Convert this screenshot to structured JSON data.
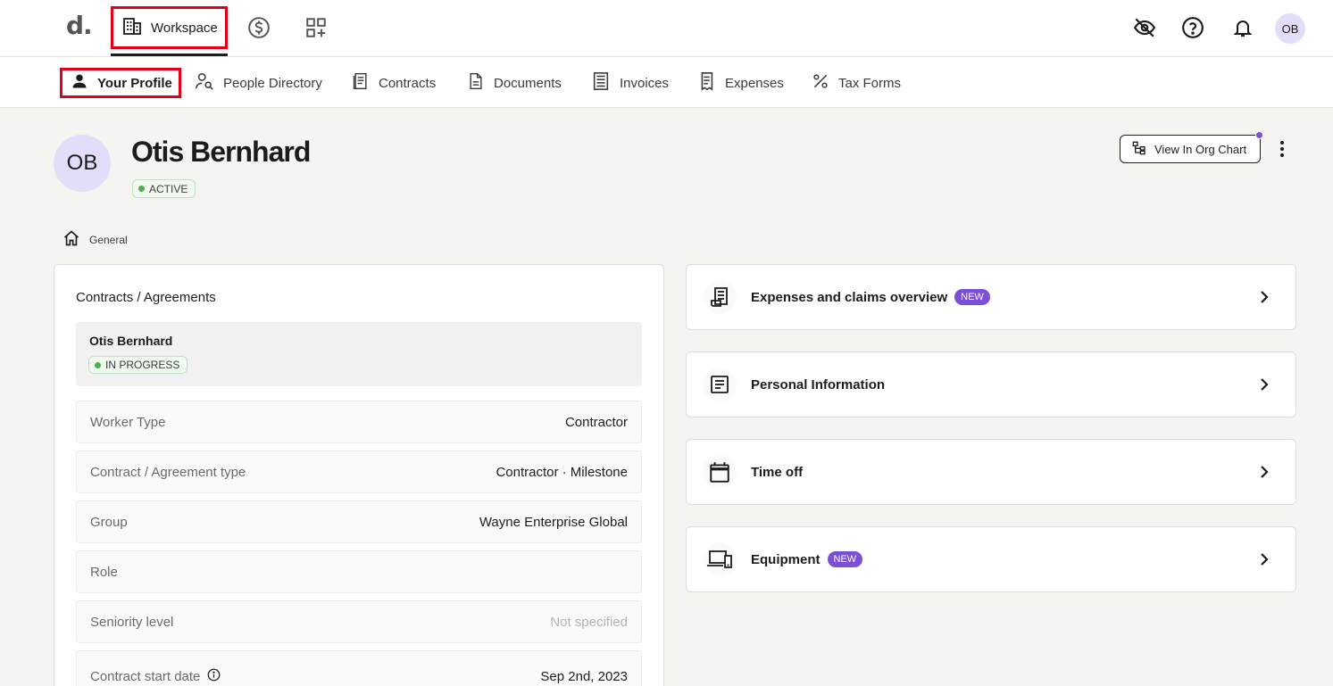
{
  "topbar": {
    "logo": "d.",
    "workspace_label": "Workspace",
    "avatar_initials": "OB",
    "icons": [
      "building-icon",
      "dollar-circle-icon",
      "apps-add-icon",
      "eye-off-icon",
      "help-icon",
      "bell-icon"
    ]
  },
  "subnav": {
    "items": [
      {
        "label": "Your Profile",
        "icon": "person-icon"
      },
      {
        "label": "People Directory",
        "icon": "person-search-icon"
      },
      {
        "label": "Contracts",
        "icon": "contracts-icon"
      },
      {
        "label": "Documents",
        "icon": "document-icon"
      },
      {
        "label": "Invoices",
        "icon": "invoice-icon"
      },
      {
        "label": "Expenses",
        "icon": "expense-icon"
      },
      {
        "label": "Tax Forms",
        "icon": "percent-icon"
      }
    ]
  },
  "profile": {
    "initials": "OB",
    "name": "Otis Bernhard",
    "status": "ACTIVE",
    "org_chart_button": "View In Org Chart"
  },
  "breadcrumb": {
    "label": "General"
  },
  "contracts": {
    "title": "Contracts / Agreements",
    "contract_name": "Otis Bernhard",
    "contract_status": "IN PROGRESS",
    "rows": [
      {
        "label": "Worker Type",
        "value": "Contractor"
      },
      {
        "label": "Contract / Agreement type",
        "value": "Contractor · Milestone"
      },
      {
        "label": "Group",
        "value": "Wayne Enterprise Global"
      },
      {
        "label": "Role",
        "value": ""
      },
      {
        "label": "Seniority level",
        "value": "Not specified"
      },
      {
        "label": "Contract start date",
        "value": "Sep 2nd, 2023"
      }
    ]
  },
  "sections": [
    {
      "label": "Expenses and claims overview",
      "badge": "NEW",
      "icon": "receipt-icon"
    },
    {
      "label": "Personal Information",
      "badge": "",
      "icon": "article-icon"
    },
    {
      "label": "Time off",
      "badge": "",
      "icon": "calendar-icon"
    },
    {
      "label": "Equipment",
      "badge": "NEW",
      "icon": "devices-icon"
    }
  ],
  "colors": {
    "accent": "#7b4fd8",
    "highlight_border": "#e0001a",
    "status_green": "#4caf50",
    "avatar_bg": "#e4dcf9"
  }
}
